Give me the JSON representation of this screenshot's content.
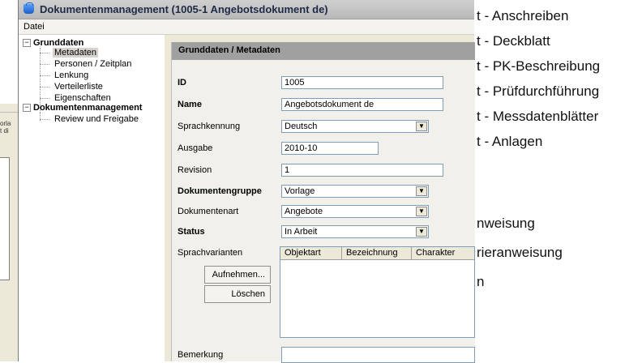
{
  "background_window": {
    "fragment_text": "orla\nt di"
  },
  "document_list": [
    "t - Anschreiben",
    "t - Deckblatt",
    "t - PK-Beschreibung",
    "t - Prüfdurchführung",
    "t - Messdatenblätter",
    "t - Anlagen",
    "nweisung",
    "rieranweisung",
    "n"
  ],
  "window": {
    "title": "Dokumentenmanagement  (1005-1 Angebotsdokument de)",
    "menu": [
      "Datei"
    ]
  },
  "tree": {
    "groups": [
      {
        "label": "Grunddaten",
        "expander": "−",
        "children": [
          "Metadaten",
          "Personen / Zeitplan",
          "Lenkung",
          "Verteilerliste",
          "Eigenschaften"
        ]
      },
      {
        "label": "Dokumentenmanagement",
        "expander": "−",
        "children": [
          "Review und Freigabe"
        ]
      }
    ],
    "selected": "Metadaten"
  },
  "panel": {
    "header": "Grunddaten / Metadaten",
    "fields": {
      "id": {
        "label": "ID",
        "value": "1005"
      },
      "name": {
        "label": "Name",
        "value": "Angebotsdokument de"
      },
      "sprachkennung": {
        "label": "Sprachkennung",
        "value": "Deutsch"
      },
      "ausgabe": {
        "label": "Ausgabe",
        "value": "2010-10"
      },
      "revision": {
        "label": "Revision",
        "value": "1"
      },
      "dokumentengruppe": {
        "label": "Dokumentengruppe",
        "value": "Vorlage"
      },
      "dokumentenart": {
        "label": "Dokumentenart",
        "value": "Angebote"
      },
      "status": {
        "label": "Status",
        "value": "In Arbeit"
      },
      "sprachvarianten": {
        "label": "Sprachvarianten"
      },
      "bemerkung": {
        "label": "Bemerkung",
        "value": ""
      }
    },
    "buttons": {
      "add": "Aufnehmen...",
      "delete": "Löschen"
    },
    "grid_columns": [
      "Objektart",
      "Bezeichnung",
      "Charakter"
    ]
  },
  "icons": {
    "dropdown": "▼"
  }
}
